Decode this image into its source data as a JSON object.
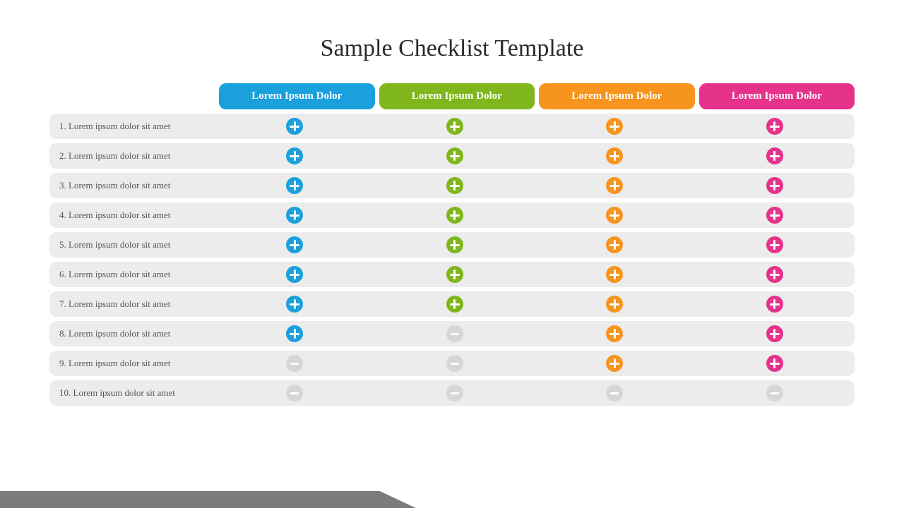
{
  "title": "Sample Checklist Template",
  "columns": [
    {
      "label": "Lorem Ipsum Dolor",
      "color": "#1aa0dd"
    },
    {
      "label": "Lorem Ipsum Dolor",
      "color": "#7fb61b"
    },
    {
      "label": "Lorem Ipsum Dolor",
      "color": "#f6941d"
    },
    {
      "label": "Lorem Ipsum Dolor",
      "color": "#e5328a"
    }
  ],
  "rows": [
    {
      "label": "1. Lorem ipsum dolor sit amet",
      "cells": [
        "plus",
        "plus",
        "plus",
        "plus"
      ]
    },
    {
      "label": "2. Lorem ipsum dolor sit amet",
      "cells": [
        "plus",
        "plus",
        "plus",
        "plus"
      ]
    },
    {
      "label": "3. Lorem ipsum dolor sit amet",
      "cells": [
        "plus",
        "plus",
        "plus",
        "plus"
      ]
    },
    {
      "label": "4. Lorem ipsum dolor sit amet",
      "cells": [
        "plus",
        "plus",
        "plus",
        "plus"
      ]
    },
    {
      "label": "5. Lorem ipsum dolor sit amet",
      "cells": [
        "plus",
        "plus",
        "plus",
        "plus"
      ]
    },
    {
      "label": "6. Lorem ipsum dolor sit amet",
      "cells": [
        "plus",
        "plus",
        "plus",
        "plus"
      ]
    },
    {
      "label": "7. Lorem ipsum dolor sit amet",
      "cells": [
        "plus",
        "plus",
        "plus",
        "plus"
      ]
    },
    {
      "label": "8. Lorem ipsum dolor sit amet",
      "cells": [
        "plus",
        "minus",
        "plus",
        "plus"
      ]
    },
    {
      "label": "9. Lorem ipsum dolor sit amet",
      "cells": [
        "minus",
        "minus",
        "plus",
        "plus"
      ]
    },
    {
      "label": "10. Lorem ipsum dolor sit amet",
      "cells": [
        "minus",
        "minus",
        "minus",
        "minus"
      ]
    }
  ],
  "icon_colors": {
    "plus": [
      "#1aa0dd",
      "#7fb61b",
      "#f6941d",
      "#e5328a"
    ],
    "minus": "#d6d6d6"
  }
}
